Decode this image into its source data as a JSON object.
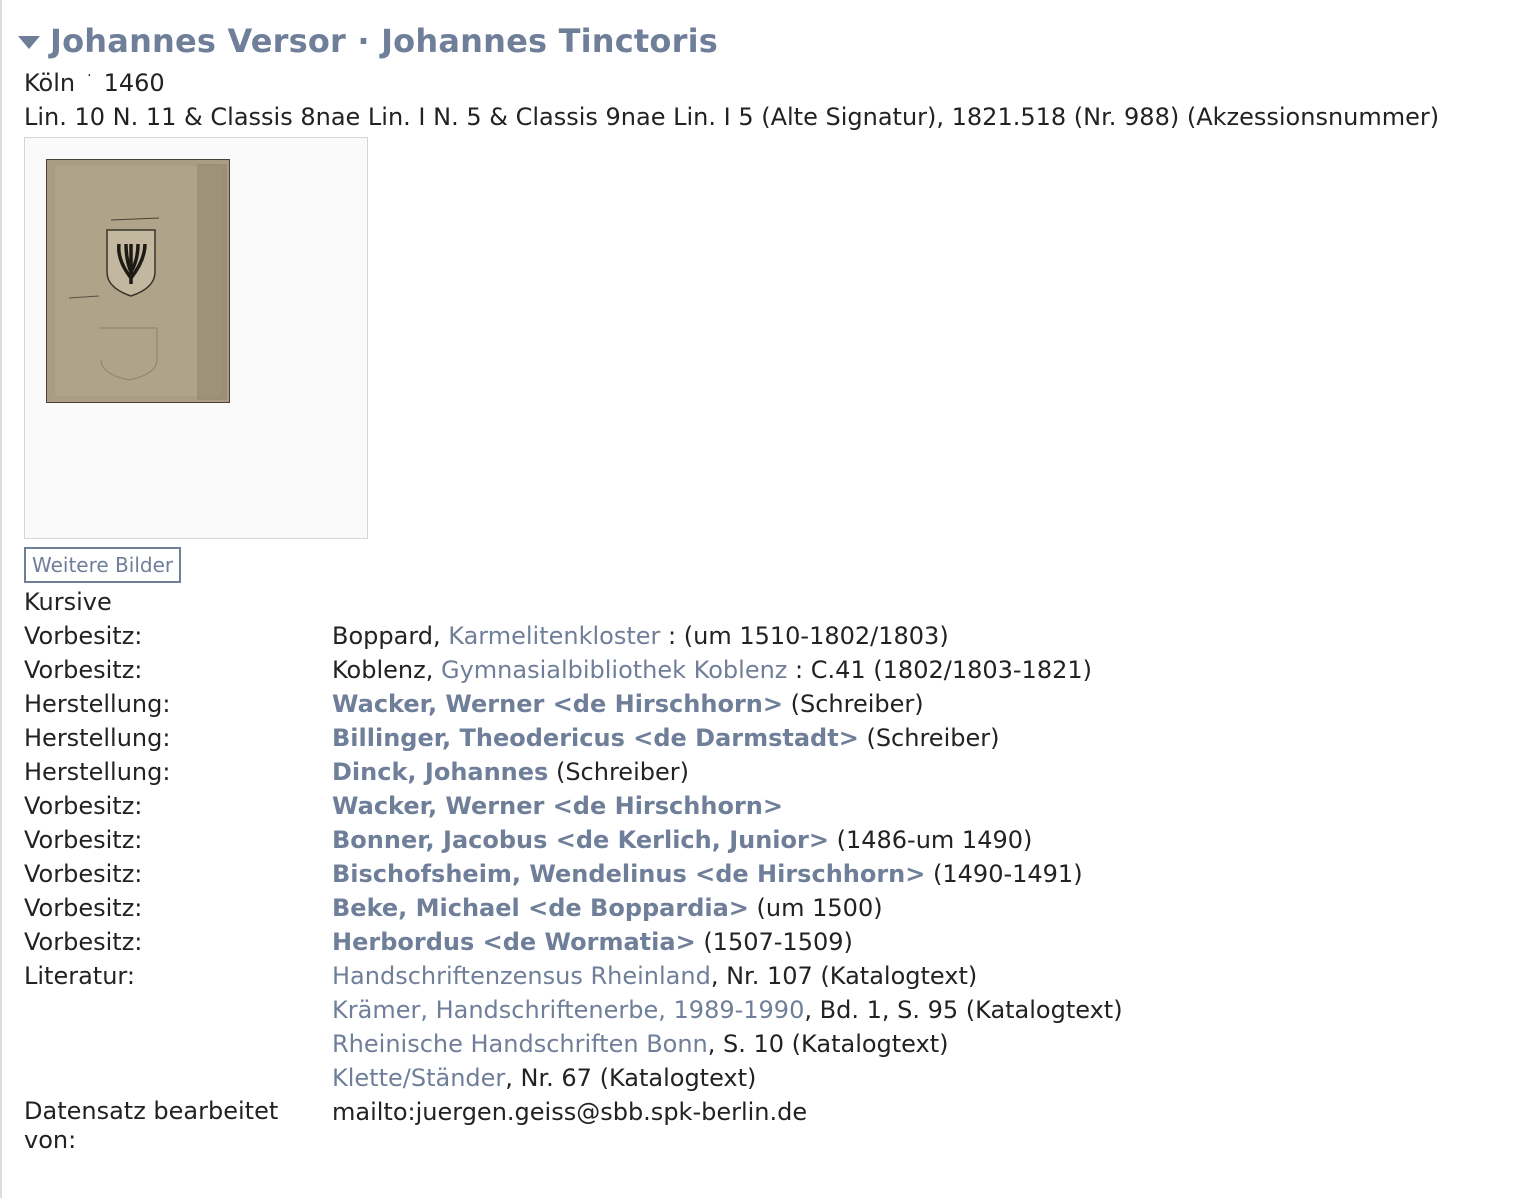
{
  "title": "Johannes Versor · Johannes Tinctoris",
  "place": "Köln",
  "dot": "·",
  "year": "1460",
  "signature": "Lin. 10 N. 11 & Classis 8nae Lin. I N. 5 & Classis 9nae Lin. I 5 (Alte Signatur), 1821.518 (Nr. 988) (Akzessionsnummer)",
  "more_images_button": "Weitere Bilder",
  "script_type": "Kursive",
  "provenance": [
    {
      "label": "Vorbesitz:",
      "pre": "Boppard, ",
      "link": "Karmelitenkloster",
      "post": " : (um 1510-1802/1803)"
    },
    {
      "label": "Vorbesitz:",
      "pre": "Koblenz, ",
      "link": "Gymnasialbibliothek Koblenz",
      "post": " : C.41 (1802/1803-1821)"
    }
  ],
  "persons": [
    {
      "label": "Herstellung:",
      "link": "Wacker, Werner <de Hirschhorn>",
      "post": " (Schreiber)"
    },
    {
      "label": "Herstellung:",
      "link": "Billinger, Theodericus <de Darmstadt>",
      "post": " (Schreiber)"
    },
    {
      "label": "Herstellung:",
      "link": "Dinck, Johannes",
      "post": " (Schreiber)"
    },
    {
      "label": "Vorbesitz:",
      "link": "Wacker, Werner <de Hirschhorn>",
      "post": ""
    },
    {
      "label": "Vorbesitz:",
      "link": "Bonner, Jacobus <de Kerlich, Junior>",
      "post": " (1486-um 1490)"
    },
    {
      "label": "Vorbesitz:",
      "link": "Bischofsheim, Wendelinus <de Hirschhorn>",
      "post": " (1490-1491)"
    },
    {
      "label": "Vorbesitz:",
      "link": "Beke, Michael <de Boppardia>",
      "post": " (um 1500)"
    },
    {
      "label": "Vorbesitz:",
      "link": "Herbordus <de Wormatia>",
      "post": " (1507-1509)"
    }
  ],
  "literature_label": "Literatur:",
  "literature": [
    {
      "link": "Handschriftenzensus Rheinland",
      "post": ", Nr. 107 (Katalogtext)"
    },
    {
      "link": "Krämer, Handschriftenerbe, 1989-1990",
      "post": ", Bd. 1, S. 95 (Katalogtext)"
    },
    {
      "link": "Rheinische Handschriften Bonn",
      "post": ", S. 10 (Katalogtext)"
    },
    {
      "link": "Klette/Ständer",
      "post": ", Nr. 67 (Katalogtext)"
    }
  ],
  "edited_by_label": "Datensatz bearbeitet von:",
  "edited_by_value": "mailto:juergen.geiss@sbb.spk-berlin.de",
  "colors": {
    "link": "#6f7f99",
    "text": "#222222"
  }
}
